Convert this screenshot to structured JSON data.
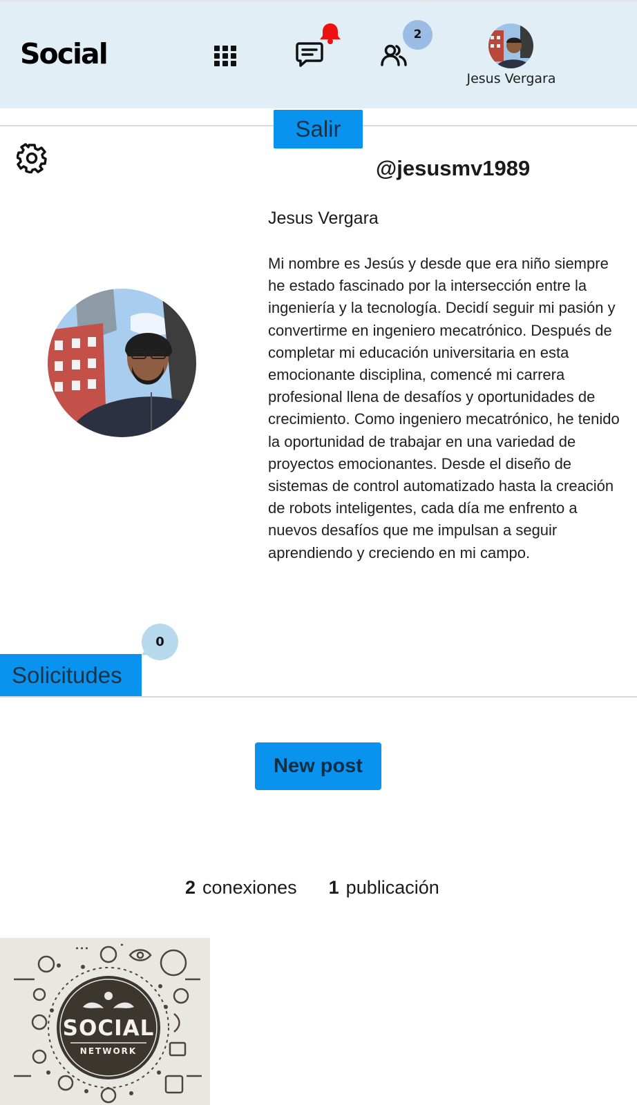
{
  "header": {
    "logo": "Social",
    "friends_badge_count": "2",
    "user_name": "Jesus Vergara",
    "icons": [
      "apps-grid-icon",
      "chat-icon",
      "bell-icon",
      "people-icon"
    ],
    "notification_color": "#ee1111"
  },
  "profile": {
    "logout_label": "Salir",
    "username": "@jesusmv1989",
    "full_name": "Jesus Vergara",
    "bio": "Mi nombre es Jesús y desde que era niño siempre he estado fascinado por la intersección entre la ingeniería y la tecnología. Decidí seguir mi pasión y convertirme en ingeniero mecatrónico. Después de completar mi educación universitaria en esta emocionante disciplina, comencé mi carrera profesional llena de desafíos y oportunidades de crecimiento. Como ingeniero mecatrónico, he tenido la oportunidad de trabajar en una variedad de proyectos emocionantes. Desde el diseño de sistemas de control automatizado hasta la creación de robots inteligentes, cada día me enfrento a nuevos desafíos que me impulsan a seguir aprendiendo y creciendo en mi campo."
  },
  "requests": {
    "label": "Solicitudes",
    "count": "0"
  },
  "actions": {
    "new_post_label": "New post"
  },
  "stats": {
    "connections_count": "2",
    "connections_label": "conexiones",
    "posts_count": "1",
    "posts_label": "publicación"
  },
  "posts": {
    "thumbnail_title": "SOCIAL",
    "thumbnail_subtitle": "NETWORK"
  },
  "colors": {
    "header_bg": "#e1eef6",
    "accent": "#0a92ef",
    "badge_blue": "#9bbce4",
    "request_badge": "#b7d9ec"
  }
}
